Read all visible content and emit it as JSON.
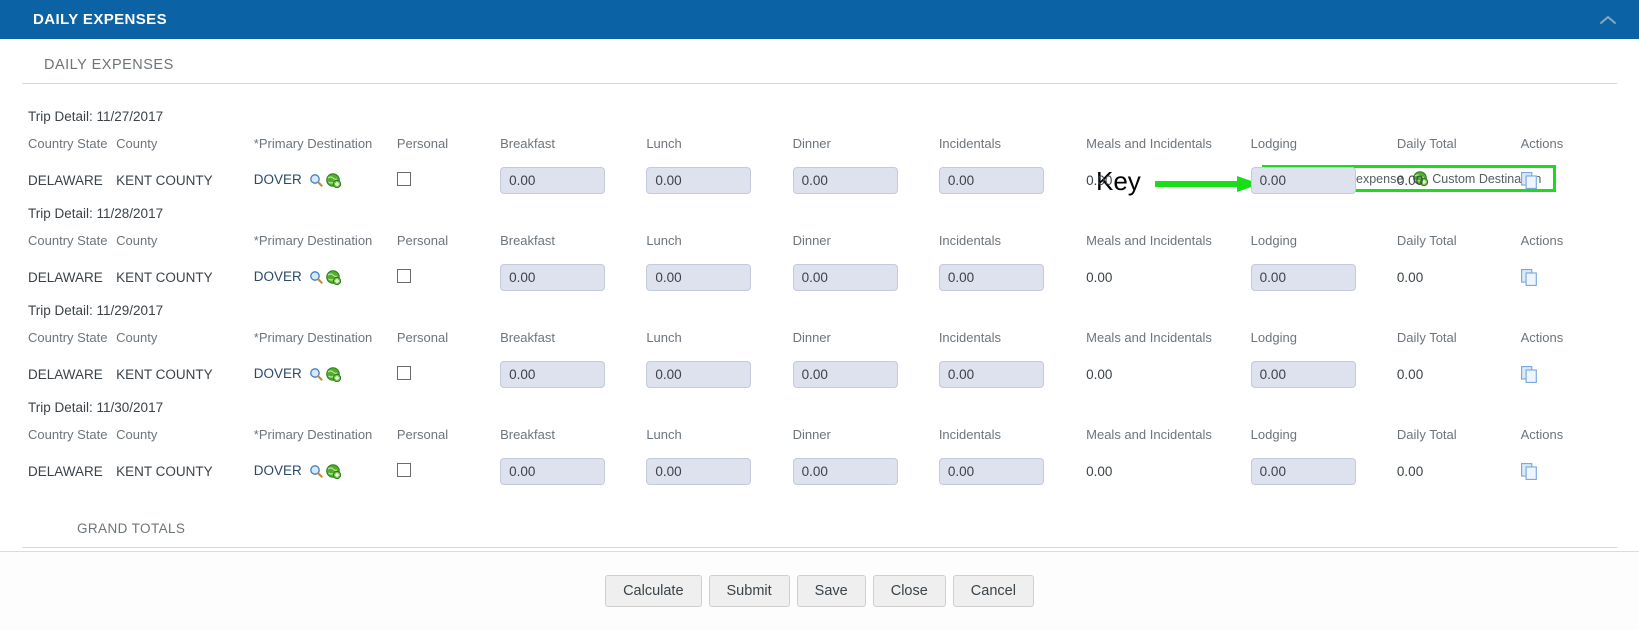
{
  "titlebar": {
    "title": "DAILY EXPENSES",
    "collapse_icon": "chevron-up-icon"
  },
  "section": {
    "label": "DAILY EXPENSES"
  },
  "key": {
    "label": "Key",
    "arrow_icon": "right-arrow-annotation",
    "highlight_color": "#19dd19",
    "items": [
      {
        "icon": "copy-down-expense-icon",
        "label": "Copy down expense"
      },
      {
        "icon": "custom-destination-globe-icon",
        "label": "Custom Destination"
      }
    ]
  },
  "columns": [
    "Country State",
    "County",
    "*Primary Destination",
    "Personal",
    "Breakfast",
    "Lunch",
    "Dinner",
    "Incidentals",
    "Meals and Incidentals",
    "Lodging",
    "Daily Total",
    "Actions"
  ],
  "trips": [
    {
      "title": "Trip Detail: 11/27/2017",
      "country_state": "DELAWARE",
      "county": "KENT COUNTY",
      "destination": "DOVER",
      "personal_checked": false,
      "breakfast": "0.00",
      "lunch": "0.00",
      "dinner": "0.00",
      "incidentals": "0.00",
      "meals_and_incidentals": "0.00",
      "lodging": "0.00",
      "daily_total": "0.00"
    },
    {
      "title": "Trip Detail: 11/28/2017",
      "country_state": "DELAWARE",
      "county": "KENT COUNTY",
      "destination": "DOVER",
      "personal_checked": false,
      "breakfast": "0.00",
      "lunch": "0.00",
      "dinner": "0.00",
      "incidentals": "0.00",
      "meals_and_incidentals": "0.00",
      "lodging": "0.00",
      "daily_total": "0.00"
    },
    {
      "title": "Trip Detail: 11/29/2017",
      "country_state": "DELAWARE",
      "county": "KENT COUNTY",
      "destination": "DOVER",
      "personal_checked": false,
      "breakfast": "0.00",
      "lunch": "0.00",
      "dinner": "0.00",
      "incidentals": "0.00",
      "meals_and_incidentals": "0.00",
      "lodging": "0.00",
      "daily_total": "0.00"
    },
    {
      "title": "Trip Detail: 11/30/2017",
      "country_state": "DELAWARE",
      "county": "KENT COUNTY",
      "destination": "DOVER",
      "personal_checked": false,
      "breakfast": "0.00",
      "lunch": "0.00",
      "dinner": "0.00",
      "incidentals": "0.00",
      "meals_and_incidentals": "0.00",
      "lodging": "0.00",
      "daily_total": "0.00"
    }
  ],
  "grand_totals": {
    "label": "GRAND TOTALS"
  },
  "footer": {
    "buttons": [
      "Calculate",
      "Submit",
      "Save",
      "Close",
      "Cancel"
    ]
  },
  "colors": {
    "header_blue": "#0b63a5",
    "input_fill": "#dde2ee",
    "key_green": "#19dd19"
  }
}
